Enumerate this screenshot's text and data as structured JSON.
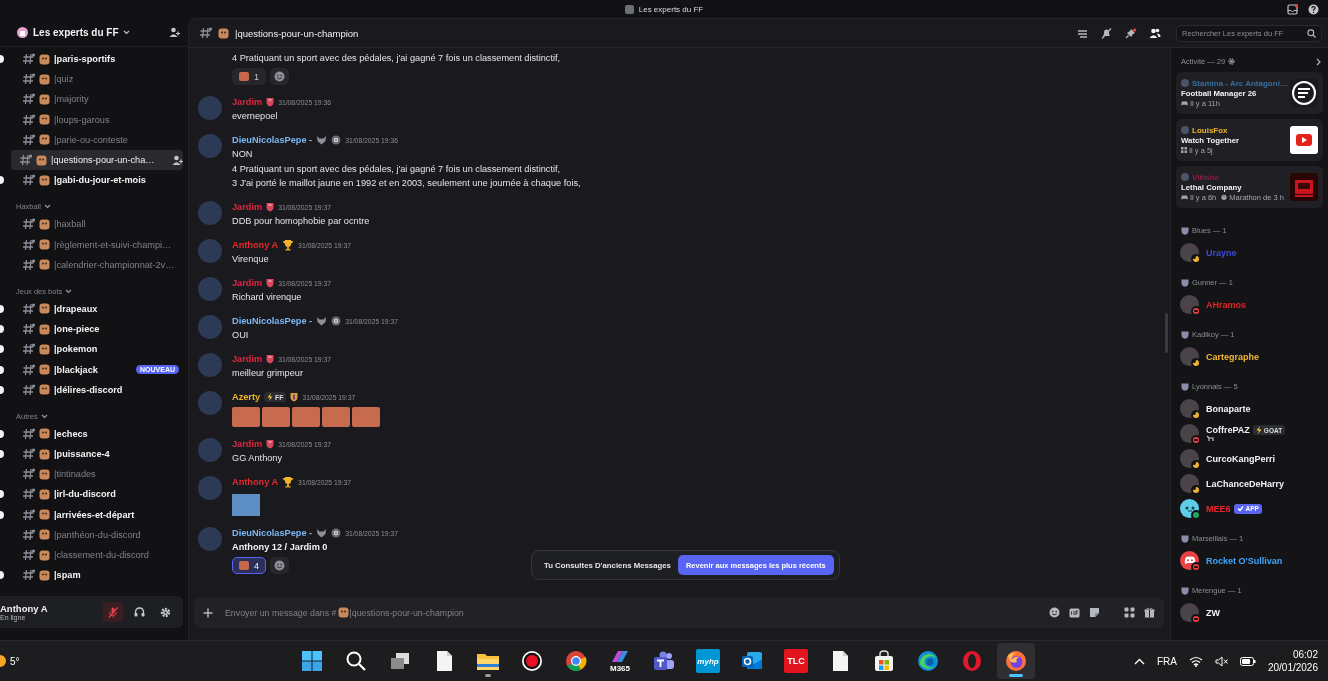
{
  "titlebar": {
    "title": "Les experts du FF"
  },
  "server": {
    "name": "Les experts du FF"
  },
  "channel_groups": [
    {
      "channels": [
        {
          "name": "|paris-sportifs",
          "unread": true,
          "selected": false
        },
        {
          "name": "|quiz",
          "unread": false,
          "selected": false
        },
        {
          "name": "|majority",
          "unread": false,
          "selected": false
        },
        {
          "name": "|loups-garous",
          "unread": false,
          "selected": false
        },
        {
          "name": "|parie-ou-conteste",
          "unread": false,
          "selected": false
        },
        {
          "name": "|questions-pour-un-cha…",
          "unread": false,
          "selected": true
        },
        {
          "name": "|gabi-du-jour-et-mois",
          "unread": true,
          "selected": false
        }
      ]
    },
    {
      "name": "Haxball",
      "channels": [
        {
          "name": "|haxball",
          "unread": false,
          "selected": false
        },
        {
          "name": "|règlement-et-suivi-champi…",
          "unread": false,
          "selected": false
        },
        {
          "name": "|calendrier-championnat-2v…",
          "unread": false,
          "selected": false
        }
      ]
    },
    {
      "name": "Jeux des bots",
      "channels": [
        {
          "name": "|drapeaux",
          "unread": true,
          "selected": false
        },
        {
          "name": "|one-piece",
          "unread": true,
          "selected": false
        },
        {
          "name": "|pokemon",
          "unread": true,
          "selected": false
        },
        {
          "name": "|blackjack",
          "unread": true,
          "selected": false,
          "badge": "NOUVEAU"
        },
        {
          "name": "|délires-discord",
          "unread": true,
          "selected": false
        }
      ]
    },
    {
      "name": "Autres",
      "channels": [
        {
          "name": "|echecs",
          "unread": true,
          "selected": false
        },
        {
          "name": "|puissance-4",
          "unread": true,
          "selected": false
        },
        {
          "name": "|tintinades",
          "unread": false,
          "selected": false
        },
        {
          "name": "|irl-du-discord",
          "unread": true,
          "selected": false
        },
        {
          "name": "|arrivées-et-départ",
          "unread": true,
          "selected": false
        },
        {
          "name": "|panthéon-du-discord",
          "unread": false,
          "selected": false
        },
        {
          "name": "|classement-du-discord",
          "unread": false,
          "selected": false
        },
        {
          "name": "|spam",
          "unread": true,
          "selected": false
        }
      ]
    }
  ],
  "user_panel": {
    "name": "Anthony A",
    "status": "En ligne",
    "mic_muted": true
  },
  "header": {
    "channel": "|questions-pour-un-champion",
    "search_placeholder": "Rechercher Les experts du FF"
  },
  "messages": [
    {
      "continuation": true,
      "lines": [
        "4 Pratiquant un sport avec des pédales, j'ai gagné 7 fois un classement distinctif,"
      ],
      "reactions": [
        {
          "count": "1",
          "selected": false
        }
      ]
    },
    {
      "continuation": false,
      "author": "Jardim",
      "color": "#e0263f",
      "badges": [
        {
          "kind": "crest"
        }
      ],
      "time": "31/08/2025 19:36",
      "lines": [
        "evernepoel"
      ]
    },
    {
      "continuation": false,
      "author": "DieuNicolasPepe -",
      "color": "#7ab8f5",
      "badges": [
        {
          "kind": "wolf"
        },
        {
          "kind": "disc"
        }
      ],
      "time": "31/08/2025 19:36",
      "lines": [
        "NON",
        "4 Pratiquant un sport avec des pédales, j'ai gagné 7 fois un classement distinctif,",
        "3 J'ai porté le maillot jaune en 1992 et en 2003, seulement une journée à chaque fois,"
      ]
    },
    {
      "continuation": false,
      "author": "Jardim",
      "color": "#e0263f",
      "badges": [
        {
          "kind": "crest"
        }
      ],
      "time": "31/08/2025 19:37",
      "lines": [
        "DDB pour homophobie par ocntre"
      ]
    },
    {
      "continuation": false,
      "author": "Anthony A",
      "color": "#e8262d",
      "badges": [
        {
          "kind": "trophy"
        }
      ],
      "time": "31/08/2025 19:37",
      "lines": [
        "Virenque"
      ]
    },
    {
      "continuation": false,
      "author": "Jardim",
      "color": "#e0263f",
      "badges": [
        {
          "kind": "crest"
        }
      ],
      "time": "31/08/2025 19:37",
      "lines": [
        "Richard virenque"
      ]
    },
    {
      "continuation": false,
      "author": "DieuNicolasPepe -",
      "color": "#7ab8f5",
      "badges": [
        {
          "kind": "wolf"
        },
        {
          "kind": "disc"
        }
      ],
      "time": "31/08/2025 19:37",
      "lines": [
        "OUI"
      ]
    },
    {
      "continuation": false,
      "author": "Jardim",
      "color": "#e0263f",
      "badges": [
        {
          "kind": "crest"
        }
      ],
      "time": "31/08/2025 19:37",
      "lines": [
        "meilleur grimpeur"
      ]
    },
    {
      "continuation": false,
      "author": "Azerty",
      "color": "#f0b429",
      "tag": "FF",
      "badges": [
        {
          "kind": "shield"
        }
      ],
      "time": "31/08/2025 19:37",
      "attachments": [
        {
          "kind": "emoji"
        },
        {
          "kind": "emoji"
        },
        {
          "kind": "emoji"
        },
        {
          "kind": "emoji"
        },
        {
          "kind": "emoji"
        }
      ]
    },
    {
      "continuation": false,
      "author": "Jardim",
      "color": "#e0263f",
      "badges": [
        {
          "kind": "crest"
        }
      ],
      "time": "31/08/2025 19:37",
      "lines": [
        "GG Anthony"
      ]
    },
    {
      "continuation": false,
      "author": "Anthony A",
      "color": "#e8262d",
      "badges": [
        {
          "kind": "trophy"
        }
      ],
      "time": "31/08/2025 19:37",
      "attachments": [
        {
          "kind": "image"
        }
      ]
    },
    {
      "continuation": false,
      "author": "DieuNicolasPepe -",
      "color": "#7ab8f5",
      "badges": [
        {
          "kind": "wolf"
        },
        {
          "kind": "disc"
        }
      ],
      "time": "31/08/2025 19:37",
      "bold": true,
      "lines": [
        "Anthony 12 / Jardim 0"
      ],
      "reactions": [
        {
          "count": "4",
          "selected": true
        }
      ]
    }
  ],
  "toast": {
    "text": "Tu Consultes D'anciens Messages",
    "button": "Revenir aux messages les plus récents"
  },
  "composer": {
    "hint_start": "Envoyer un message dans #",
    "hint_channel": "|questions-pour-un-champion"
  },
  "members": {
    "activity_header": "Activité — 29",
    "activities": [
      {
        "user": "Stamina - Arc Antagoni…",
        "color": "#3a6f9e",
        "title": "Football Manager 26",
        "meta": [
          {
            "kind": "game",
            "text": "Il y a 11h"
          }
        ],
        "thumb": {
          "kind": "logo"
        }
      },
      {
        "user": "LouisFox",
        "color": "#f0b429",
        "title": "Watch Together",
        "meta": [
          {
            "kind": "app",
            "text": "Il y a 5j"
          }
        ],
        "thumb": {
          "kind": "play"
        }
      },
      {
        "user": "Vitinho",
        "color": "#8a1f45",
        "title": "Lethal Company",
        "meta": [
          {
            "kind": "game",
            "text": "Il y a 6h"
          },
          {
            "kind": "clock",
            "text": "Marathon de 3 h"
          }
        ],
        "thumb": {
          "kind": "art"
        }
      }
    ],
    "groups": [
      {
        "name": "Blues — 1",
        "members": [
          {
            "name": "Urayne",
            "color": "#3d47d9",
            "status": {
              "kind": "idle",
              "color": "#f0b232"
            },
            "avatar": {
              "kind": "photo"
            }
          }
        ]
      },
      {
        "name": "Gunner — 1",
        "members": [
          {
            "name": "AHramos",
            "color": "#e02424",
            "status": {
              "kind": "dnd",
              "color": "#f23f43"
            },
            "avatar": {
              "kind": "photo"
            }
          }
        ]
      },
      {
        "name": "Kadikoy — 1",
        "members": [
          {
            "name": "Cartegraphe",
            "color": "#f5b82e",
            "status": {
              "kind": "idle",
              "color": "#f0b232"
            },
            "avatar": {
              "kind": "photo"
            }
          }
        ]
      },
      {
        "name": "Lyonnais — 5",
        "members": [
          {
            "name": "Bonaparte",
            "color": "#f2f3f5",
            "status": {
              "kind": "idle",
              "color": "#f0b232"
            },
            "avatar": {
              "kind": "photo"
            }
          },
          {
            "name": "CoffrePAZ",
            "color": "#f2f3f5",
            "status": {
              "kind": "dnd",
              "color": "#f23f43"
            },
            "avatar": {
              "kind": "photo"
            },
            "tag": {
              "kind": "role",
              "text": "GOAT"
            },
            "status_emoji": true
          },
          {
            "name": "CurcoKangPerri",
            "color": "#f2f3f5",
            "status": {
              "kind": "idle",
              "color": "#f0b232"
            },
            "avatar": {
              "kind": "photo"
            }
          },
          {
            "name": "LaChanceDeHarry",
            "color": "#f2f3f5",
            "status": {
              "kind": "idle",
              "color": "#f0b232"
            },
            "avatar": {
              "kind": "photo"
            }
          },
          {
            "name": "MEE6",
            "color": "#e8262d",
            "status": {
              "kind": "online",
              "color": "#23a55a"
            },
            "avatar": {
              "kind": "bot"
            },
            "tag": {
              "kind": "app",
              "text": "APP"
            }
          }
        ]
      },
      {
        "name": "Marseillais — 1",
        "members": [
          {
            "name": "Rocket O'Sullivan",
            "color": "#3ea6ff",
            "status": {
              "kind": "dnd",
              "color": "#f23f43"
            },
            "avatar": {
              "kind": "logo"
            }
          }
        ]
      },
      {
        "name": "Merengue — 1",
        "members": [
          {
            "name": "ZW",
            "color": "#f2f3f5",
            "status": {
              "kind": "dnd",
              "color": "#f23f43"
            },
            "avatar": {
              "kind": "photo"
            }
          }
        ]
      }
    ]
  },
  "taskbar": {
    "weather": "5°",
    "apps": [
      {
        "kind": "start",
        "running": false,
        "selected": false
      },
      {
        "kind": "search",
        "running": false,
        "selected": false
      },
      {
        "kind": "taskview",
        "running": false,
        "selected": false
      },
      {
        "kind": "file",
        "running": false,
        "selected": false
      },
      {
        "kind": "folder",
        "running": true,
        "selected": false
      },
      {
        "kind": "record",
        "running": false,
        "selected": false
      },
      {
        "kind": "chrome",
        "running": false,
        "selected": false
      },
      {
        "kind": "m365",
        "label": "M365",
        "running": false,
        "selected": false
      },
      {
        "kind": "teams",
        "running": false,
        "selected": false
      },
      {
        "kind": "tile",
        "label": "myhp",
        "running": false,
        "selected": false
      },
      {
        "kind": "mail",
        "running": false,
        "selected": false
      },
      {
        "kind": "tile-red",
        "label": "TLC",
        "running": false,
        "selected": false
      },
      {
        "kind": "file",
        "running": false,
        "selected": false
      },
      {
        "kind": "store",
        "running": false,
        "selected": false
      },
      {
        "kind": "edge",
        "running": false,
        "selected": false
      },
      {
        "kind": "opera",
        "running": false,
        "selected": false
      },
      {
        "kind": "firefox",
        "running": true,
        "selected": true
      }
    ],
    "language": "FRA",
    "time": "06:02",
    "date": "20/01/2026"
  }
}
